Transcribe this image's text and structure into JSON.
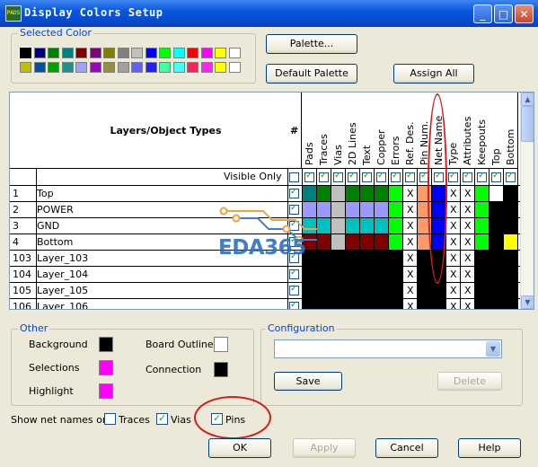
{
  "window": {
    "title": "Display Colors Setup",
    "icon_text": "PADS",
    "controls": {
      "minimize": "_",
      "maximize": "□",
      "close": "✕"
    }
  },
  "selected_color": {
    "label": "Selected Color",
    "row1": [
      "#000000",
      "#000080",
      "#008000",
      "#008080",
      "#800000",
      "#800080",
      "#808000",
      "#808080",
      "#c0c0c0",
      "#0000ff",
      "#00ff00",
      "#00ffff",
      "#ff0000",
      "#ff00ff",
      "#ffff00",
      "#ffffff"
    ],
    "row2": [
      "#c0c000",
      "#0050a0",
      "#00a000",
      "#209090",
      "#a0a0ff",
      "#a000c0",
      "#909040",
      "#a0a0a0",
      "#6060ff",
      "#2020ff",
      "#40ffa0",
      "#40ffff",
      "#ff2060",
      "#ff20ff",
      "#ffff00",
      "#ffffff"
    ]
  },
  "buttons": {
    "palette": "Palette...",
    "default_palette": "Default Palette",
    "assign_all": "Assign All",
    "save": "Save",
    "delete": "Delete",
    "ok": "OK",
    "apply": "Apply",
    "cancel": "Cancel",
    "help": "Help"
  },
  "table": {
    "header_title": "Layers/Object Types",
    "hash": "#",
    "visible_only": "Visible Only",
    "columns": [
      "Pads",
      "Traces",
      "Vias",
      "2D Lines",
      "Text",
      "Copper",
      "Errors",
      "Ref. Des.",
      "Pin Num.",
      "Net Name",
      "Type",
      "Attributes",
      "Keepouts",
      "Top",
      "Bottom"
    ],
    "rows": [
      {
        "num": "1",
        "name": "Top"
      },
      {
        "num": "2",
        "name": "POWER"
      },
      {
        "num": "3",
        "name": "GND"
      },
      {
        "num": "4",
        "name": "Bottom"
      },
      {
        "num": "103",
        "name": "Layer_103"
      },
      {
        "num": "104",
        "name": "Layer_104"
      },
      {
        "num": "105",
        "name": "Layer_105"
      },
      {
        "num": "106",
        "name": "Layer_106"
      }
    ],
    "x_mark": "X",
    "cell_colors": [
      [
        "#008080",
        "#008000",
        "#c0c0c0",
        "#008000",
        "#008000",
        "#008000",
        "#00ff00",
        "#ffffff",
        "#ff9966",
        "#0000ff",
        "#ffffff",
        "#ffffff",
        "#00ff00",
        "#ffffff",
        "#000000"
      ],
      [
        "#9999ff",
        "#9999ff",
        "#c0c0c0",
        "#9999ff",
        "#9999ff",
        "#9999ff",
        "#00ff00",
        "#ffffff",
        "#ff9966",
        "#0000ff",
        "#ffffff",
        "#ffffff",
        "#00ff00",
        "#000000",
        "#000000"
      ],
      [
        "#00c0c0",
        "#00c0c0",
        "#c0c0c0",
        "#00c0c0",
        "#00c0c0",
        "#00c0c0",
        "#00ff00",
        "#ffffff",
        "#ff9966",
        "#0000ff",
        "#ffffff",
        "#ffffff",
        "#00ff00",
        "#000000",
        "#000000"
      ],
      [
        "#800000",
        "#800000",
        "#c0c0c0",
        "#800000",
        "#800000",
        "#800000",
        "#00ff00",
        "#ffffff",
        "#ff9966",
        "#0000ff",
        "#ffffff",
        "#ffffff",
        "#00ff00",
        "#000000",
        "#ffff00"
      ],
      [
        "#000000",
        "#000000",
        "#000000",
        "#000000",
        "#000000",
        "#000000",
        "#000000",
        "#ffffff",
        "#000000",
        "#000000",
        "#ffffff",
        "#ffffff",
        "#000000",
        "#000000",
        "#000000"
      ],
      [
        "#000000",
        "#000000",
        "#000000",
        "#000000",
        "#000000",
        "#000000",
        "#000000",
        "#ffffff",
        "#000000",
        "#000000",
        "#ffffff",
        "#ffffff",
        "#000000",
        "#000000",
        "#000000"
      ],
      [
        "#000000",
        "#000000",
        "#000000",
        "#000000",
        "#000000",
        "#000000",
        "#000000",
        "#ffffff",
        "#000000",
        "#000000",
        "#ffffff",
        "#ffffff",
        "#000000",
        "#000000",
        "#000000"
      ],
      [
        "#000000",
        "#000000",
        "#000000",
        "#000000",
        "#000000",
        "#000000",
        "#000000",
        "#ffffff",
        "#000000",
        "#000000",
        "#ffffff",
        "#ffffff",
        "#000000",
        "#000000",
        "#000000"
      ]
    ],
    "x_columns": [
      7,
      10,
      11
    ]
  },
  "other": {
    "label": "Other",
    "background": {
      "label": "Background",
      "color": "#000000"
    },
    "selections": {
      "label": "Selections",
      "color": "#ff00ff"
    },
    "highlight": {
      "label": "Highlight",
      "color": "#ff00ff"
    },
    "board_outline": {
      "label": "Board Outline",
      "color": "#ffffff"
    },
    "connection": {
      "label": "Connection",
      "color": "#000000"
    }
  },
  "configuration": {
    "label": "Configuration",
    "selected": ""
  },
  "net_names": {
    "label": "Show net names on",
    "traces": {
      "label": "Traces",
      "checked": false
    },
    "vias": {
      "label": "Vias",
      "checked": true
    },
    "pins": {
      "label": "Pins",
      "checked": true
    }
  },
  "watermark": "EDA365"
}
